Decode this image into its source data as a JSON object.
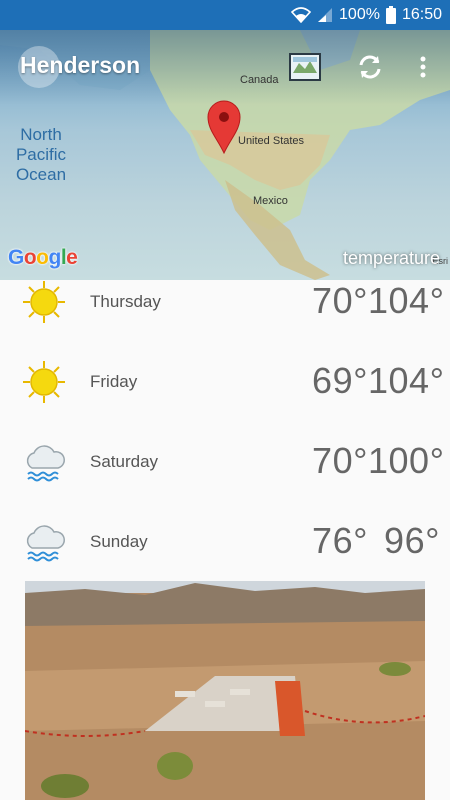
{
  "status_bar": {
    "battery": "100%",
    "time": "16:50",
    "icons": [
      "wifi-icon",
      "signal-icon",
      "battery-icon"
    ]
  },
  "header": {
    "city": "Henderson",
    "actions": [
      "map-layers-icon",
      "refresh-icon",
      "more-vert-icon"
    ]
  },
  "map": {
    "labels": {
      "canada": "Canada",
      "united_states": "United States",
      "mexico": "Mexico",
      "ocean": "North Pacific Ocean"
    },
    "google": "Google",
    "layer": "temperature",
    "attribution": "Esri"
  },
  "forecast": [
    {
      "day": "Thursday",
      "icon": "sunny-icon",
      "low": "70°",
      "high": "104°"
    },
    {
      "day": "Friday",
      "icon": "sunny-icon",
      "low": "69°",
      "high": "104°"
    },
    {
      "day": "Saturday",
      "icon": "rain-icon",
      "low": "70°",
      "high": "100°"
    },
    {
      "day": "Sunday",
      "icon": "rain-icon",
      "low": "76°",
      "high": "96°"
    }
  ],
  "colors": {
    "status_bar": "#1e6fb7",
    "sun": "#f5d90f",
    "pin": "#e53935",
    "rain": "#2f8fd8"
  }
}
